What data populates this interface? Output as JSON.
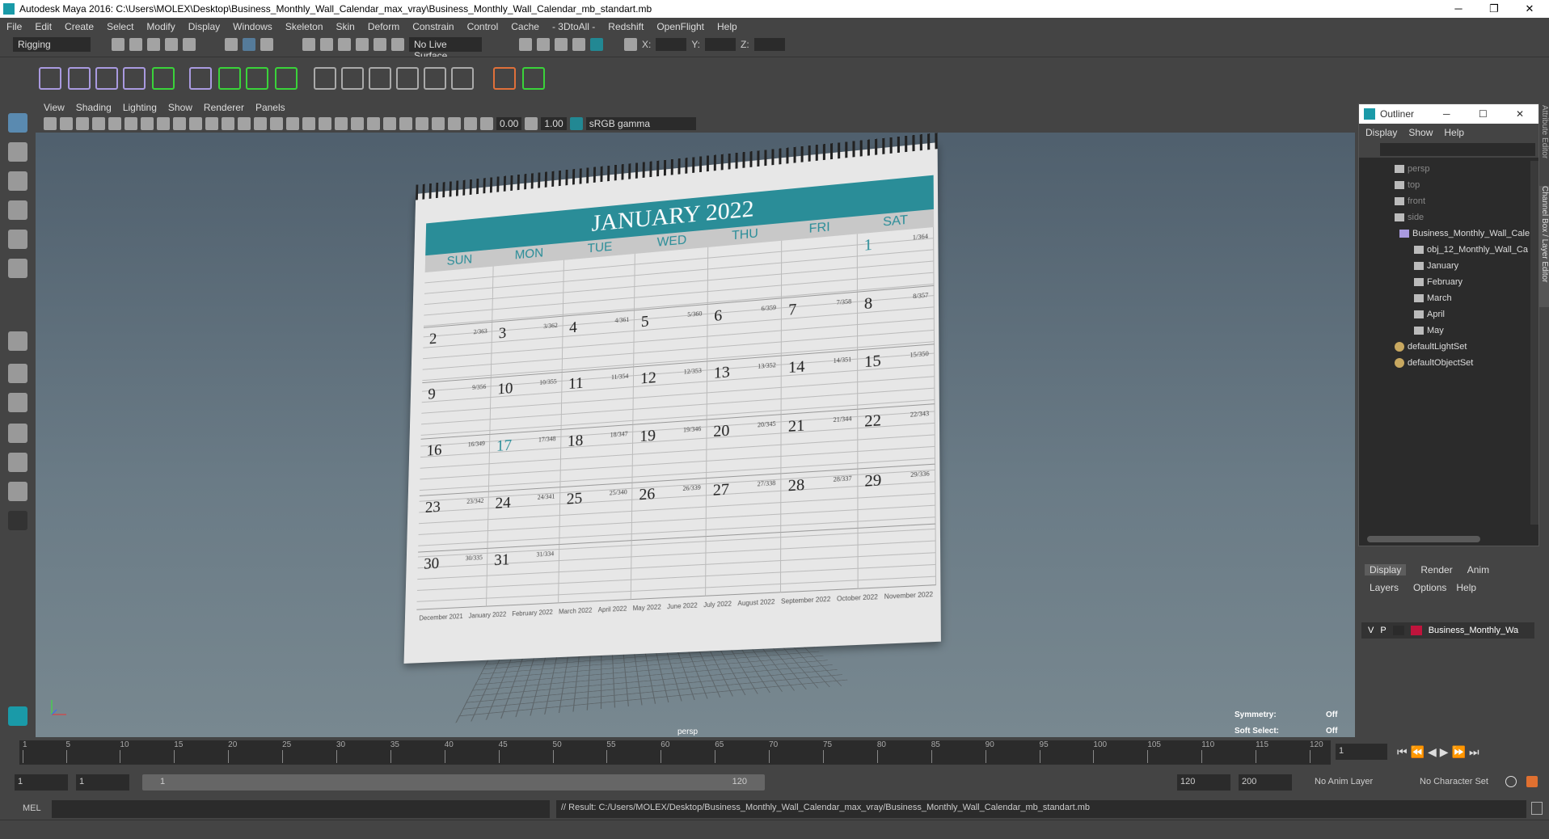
{
  "window": {
    "title": "Autodesk Maya 2016: C:\\Users\\MOLEX\\Desktop\\Business_Monthly_Wall_Calendar_max_vray\\Business_Monthly_Wall_Calendar_mb_standart.mb",
    "minimize": "─",
    "restore": "❐",
    "close": "✕"
  },
  "menu": [
    "File",
    "Edit",
    "Create",
    "Select",
    "Modify",
    "Display",
    "Windows",
    "Skeleton",
    "Skin",
    "Deform",
    "Constrain",
    "Control",
    "Cache",
    "- 3DtoAll -",
    "Redshift",
    "OpenFlight",
    "Help"
  ],
  "toolbar": {
    "mode": "Rigging",
    "live_surface": "No Live Surface",
    "x_label": "X:",
    "y_label": "Y:",
    "z_label": "Z:"
  },
  "viewport": {
    "menu": [
      "View",
      "Shading",
      "Lighting",
      "Show",
      "Renderer",
      "Panels"
    ],
    "near": "0.00",
    "far": "1.00",
    "color_space": "sRGB gamma",
    "camera_label": "persp",
    "symmetry_label": "Symmetry:",
    "symmetry_value": "Off",
    "soft_select_label": "Soft Select:",
    "soft_select_value": "Off"
  },
  "calendar": {
    "title": "JANUARY 2022",
    "days": [
      "SUN",
      "MON",
      "TUE",
      "WED",
      "THU",
      "FRI",
      "SAT"
    ],
    "cells": [
      [
        "",
        "",
        "",
        "",
        "",
        "",
        ""
      ],
      [
        "",
        "",
        "",
        "",
        "",
        "",
        "1"
      ],
      [
        "2",
        "3",
        "4",
        "5",
        "6",
        "7",
        "8"
      ],
      [
        "9",
        "10",
        "11",
        "12",
        "13",
        "14",
        "15"
      ],
      [
        "16",
        "17",
        "18",
        "19",
        "20",
        "21",
        "22"
      ],
      [
        "23",
        "24",
        "25",
        "26",
        "27",
        "28",
        "29"
      ],
      [
        "30",
        "31",
        "",
        "",
        "",
        "",
        ""
      ]
    ],
    "subs": [
      [
        "",
        "",
        "",
        "",
        "",
        "",
        ""
      ],
      [
        "",
        "",
        "",
        "",
        "",
        "",
        "1/364"
      ],
      [
        "2/363",
        "3/362",
        "4/361",
        "5/360",
        "6/359",
        "7/358",
        "8/357"
      ],
      [
        "9/356",
        "10/355",
        "11/354",
        "12/353",
        "13/352",
        "14/351",
        "15/350"
      ],
      [
        "16/349",
        "17/348",
        "18/347",
        "19/346",
        "20/345",
        "21/344",
        "22/343"
      ],
      [
        "23/342",
        "24/341",
        "25/340",
        "26/339",
        "27/338",
        "28/337",
        "29/336"
      ],
      [
        "30/335",
        "31/334",
        "",
        "",
        "",
        "",
        ""
      ]
    ],
    "minis": [
      "December 2021",
      "January 2022",
      "February 2022",
      "March 2022",
      "April 2022",
      "May 2022",
      "June 2022",
      "July 2022",
      "August 2022",
      "September 2022",
      "October 2022",
      "November 2022"
    ],
    "accent": "#2a8d98"
  },
  "outliner": {
    "title": "Outliner",
    "menu": [
      "Display",
      "Show",
      "Help"
    ],
    "items": [
      {
        "label": "persp",
        "type": "camera"
      },
      {
        "label": "top",
        "type": "camera"
      },
      {
        "label": "front",
        "type": "camera"
      },
      {
        "label": "side",
        "type": "camera"
      },
      {
        "label": "Business_Monthly_Wall_Cale",
        "type": "group"
      },
      {
        "label": "obj_12_Monthly_Wall_Ca",
        "type": "mesh"
      },
      {
        "label": "January",
        "type": "mesh"
      },
      {
        "label": "February",
        "type": "mesh"
      },
      {
        "label": "March",
        "type": "mesh"
      },
      {
        "label": "April",
        "type": "mesh"
      },
      {
        "label": "May",
        "type": "mesh"
      },
      {
        "label": "defaultLightSet",
        "type": "set"
      },
      {
        "label": "defaultObjectSet",
        "type": "set"
      }
    ],
    "side_tabs": [
      "Attribute Editor",
      "Channel Box / Layer Editor"
    ]
  },
  "layers": {
    "tabs": [
      "Display",
      "Render",
      "Anim"
    ],
    "menu": [
      "Layers",
      "Options",
      "Help"
    ],
    "layer": {
      "v": "V",
      "p": "P",
      "name": "Business_Monthly_Wa",
      "color": "#c0143c"
    }
  },
  "timeline": {
    "ticks": [
      "1",
      "5",
      "10",
      "15",
      "20",
      "25",
      "30",
      "35",
      "40",
      "45",
      "50",
      "55",
      "60",
      "65",
      "70",
      "75",
      "80",
      "85",
      "90",
      "95",
      "100",
      "105",
      "110",
      "115",
      "120"
    ],
    "current_frame": "1"
  },
  "range": {
    "start": "1",
    "playback_start": "1",
    "slider_start": "1",
    "slider_end": "120",
    "playback_end": "120",
    "end": "200",
    "anim_layer": "No Anim Layer",
    "character_set": "No Character Set"
  },
  "command": {
    "label": "MEL",
    "result": "// Result: C:/Users/MOLEX/Desktop/Business_Monthly_Wall_Calendar_max_vray/Business_Monthly_Wall_Calendar_mb_standart.mb"
  }
}
